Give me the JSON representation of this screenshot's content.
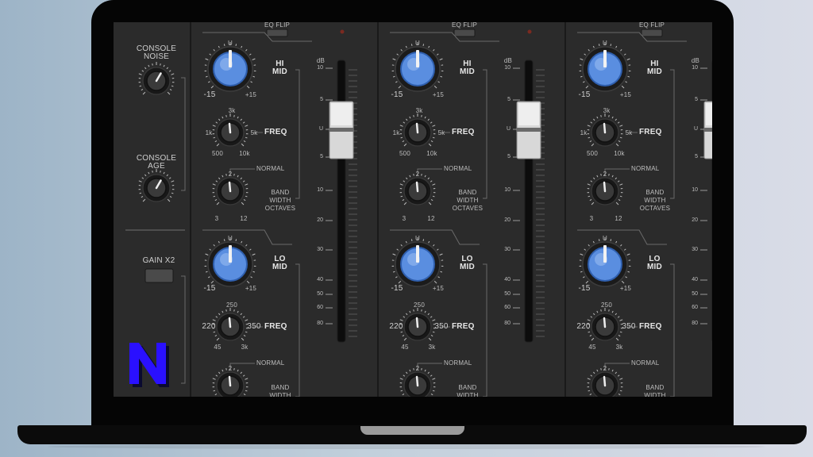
{
  "left_panel": {
    "console_noise_label": "CONSOLE\nNOISE",
    "console_age_label": "CONSOLE\nAGE",
    "gain_x2_label": "GAIN X2"
  },
  "channel": {
    "eq_flip_label": "EQ FLIP",
    "hi_mid_label": "HI\nMID",
    "freq_label": "FREQ",
    "bandwidth_label": "BAND\nWIDTH\nOCTAVES",
    "normal_label": "NORMAL",
    "lo_mid_label": "LO\nMID",
    "gain_min": "-15",
    "gain_max": "+15",
    "gain_center": "U",
    "hi_freq_low": "500",
    "hi_freq_high": "10k",
    "hi_freq_top": "3k",
    "hi_freq_left": "1k",
    "hi_freq_right": "5k",
    "lo_freq_left": "220",
    "lo_freq_right": "350",
    "lo_freq_top": "250",
    "lo_freq_low": "45",
    "lo_freq_high": "3k",
    "bw_low": "3",
    "bw_high": "12",
    "bw_top": "2",
    "fader_db_label": "dB",
    "fader_scale": [
      "10",
      "5",
      "U",
      "5",
      "10",
      "20",
      "30",
      "40",
      "50",
      "60",
      "80"
    ]
  },
  "channels": [
    {
      "name": "channel-1"
    },
    {
      "name": "channel-2"
    },
    {
      "name": "channel-3"
    }
  ],
  "logo": {
    "letter": "N",
    "color": "#2a10ff"
  },
  "colors": {
    "knob_blue": "#5a8ee0",
    "panel": "#2b2b2b"
  }
}
